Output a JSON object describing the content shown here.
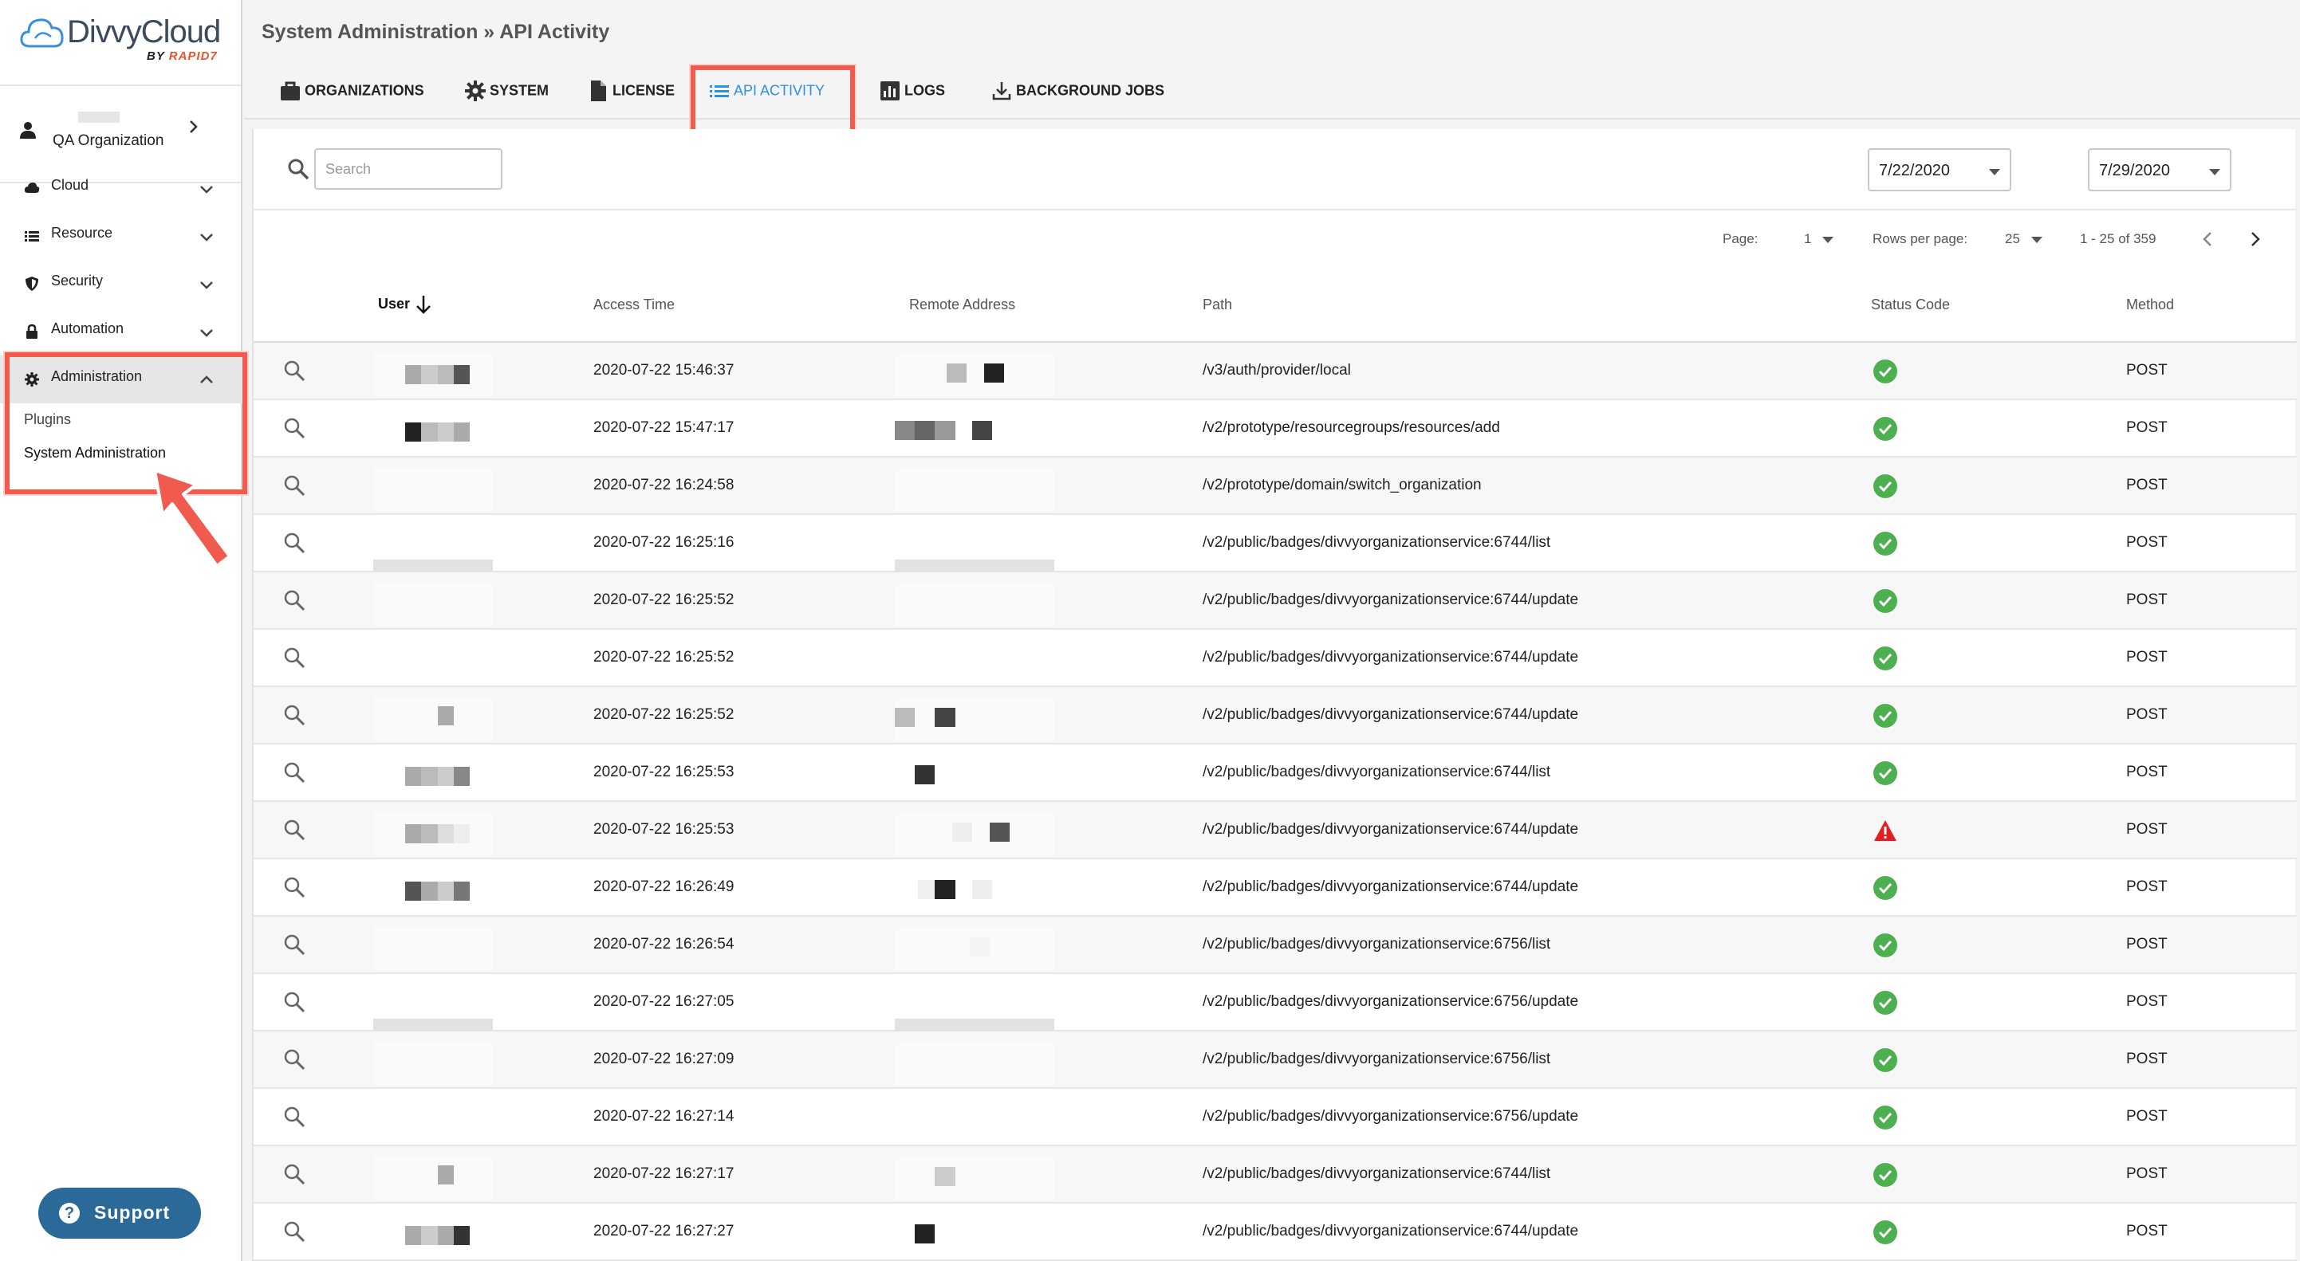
{
  "brand": {
    "name": "DivvyCloud",
    "by": "BY ",
    "rapid": "RAPID7"
  },
  "org": {
    "name": "QA Organization"
  },
  "sidebar": {
    "items": [
      {
        "label": "Cloud",
        "icon": "cloud-icon"
      },
      {
        "label": "Resource",
        "icon": "list-icon"
      },
      {
        "label": "Security",
        "icon": "shield-icon"
      },
      {
        "label": "Automation",
        "icon": "lock-icon"
      },
      {
        "label": "Administration",
        "icon": "gear-icon"
      }
    ],
    "sub_items": [
      {
        "label": "Plugins"
      },
      {
        "label": "System Administration"
      }
    ]
  },
  "support": {
    "label": "Support"
  },
  "breadcrumb": "System Administration » API Activity",
  "tabs": [
    {
      "label": "ORGANIZATIONS",
      "icon": "briefcase-icon"
    },
    {
      "label": "SYSTEM",
      "icon": "gear-icon"
    },
    {
      "label": "LICENSE",
      "icon": "document-icon"
    },
    {
      "label": "API ACTIVITY",
      "icon": "list-icon",
      "active": true
    },
    {
      "label": "LOGS",
      "icon": "bar-chart-icon"
    },
    {
      "label": "BACKGROUND JOBS",
      "icon": "download-icon"
    }
  ],
  "filters": {
    "search_placeholder": "Search",
    "date_from": "7/22/2020",
    "date_to": "7/29/2020"
  },
  "pagination": {
    "page_label": "Page:",
    "page": "1",
    "rows_label": "Rows per page:",
    "rows": "25",
    "range": "1 - 25 of 359"
  },
  "table": {
    "columns": [
      "User",
      "Access Time",
      "Remote Address",
      "Path",
      "Status Code",
      "Method"
    ],
    "rows": [
      {
        "time": "2020-07-22 15:46:37",
        "path": "/v3/auth/provider/local",
        "status": "ok",
        "method": "POST"
      },
      {
        "time": "2020-07-22 15:47:17",
        "path": "/v2/prototype/resourcegroups/resources/add",
        "status": "ok",
        "method": "POST"
      },
      {
        "time": "2020-07-22 16:24:58",
        "path": "/v2/prototype/domain/switch_organization",
        "status": "ok",
        "method": "POST"
      },
      {
        "time": "2020-07-22 16:25:16",
        "path": "/v2/public/badges/divvyorganizationservice:6744/list",
        "status": "ok",
        "method": "POST"
      },
      {
        "time": "2020-07-22 16:25:52",
        "path": "/v2/public/badges/divvyorganizationservice:6744/update",
        "status": "ok",
        "method": "POST"
      },
      {
        "time": "2020-07-22 16:25:52",
        "path": "/v2/public/badges/divvyorganizationservice:6744/update",
        "status": "ok",
        "method": "POST"
      },
      {
        "time": "2020-07-22 16:25:52",
        "path": "/v2/public/badges/divvyorganizationservice:6744/update",
        "status": "ok",
        "method": "POST"
      },
      {
        "time": "2020-07-22 16:25:53",
        "path": "/v2/public/badges/divvyorganizationservice:6744/list",
        "status": "ok",
        "method": "POST"
      },
      {
        "time": "2020-07-22 16:25:53",
        "path": "/v2/public/badges/divvyorganizationservice:6744/update",
        "status": "warn",
        "method": "POST"
      },
      {
        "time": "2020-07-22 16:26:49",
        "path": "/v2/public/badges/divvyorganizationservice:6744/update",
        "status": "ok",
        "method": "POST"
      },
      {
        "time": "2020-07-22 16:26:54",
        "path": "/v2/public/badges/divvyorganizationservice:6756/list",
        "status": "ok",
        "method": "POST"
      },
      {
        "time": "2020-07-22 16:27:05",
        "path": "/v2/public/badges/divvyorganizationservice:6756/update",
        "status": "ok",
        "method": "POST"
      },
      {
        "time": "2020-07-22 16:27:09",
        "path": "/v2/public/badges/divvyorganizationservice:6756/list",
        "status": "ok",
        "method": "POST"
      },
      {
        "time": "2020-07-22 16:27:14",
        "path": "/v2/public/badges/divvyorganizationservice:6756/update",
        "status": "ok",
        "method": "POST"
      },
      {
        "time": "2020-07-22 16:27:17",
        "path": "/v2/public/badges/divvyorganizationservice:6744/list",
        "status": "ok",
        "method": "POST"
      },
      {
        "time": "2020-07-22 16:27:27",
        "path": "/v2/public/badges/divvyorganizationservice:6744/update",
        "status": "ok",
        "method": "POST"
      }
    ]
  },
  "colors": {
    "accent": "#2f8fe0",
    "highlight": "#f05a4f",
    "ok": "#4caf50",
    "warn": "#e02020",
    "support": "#2b6a98"
  }
}
